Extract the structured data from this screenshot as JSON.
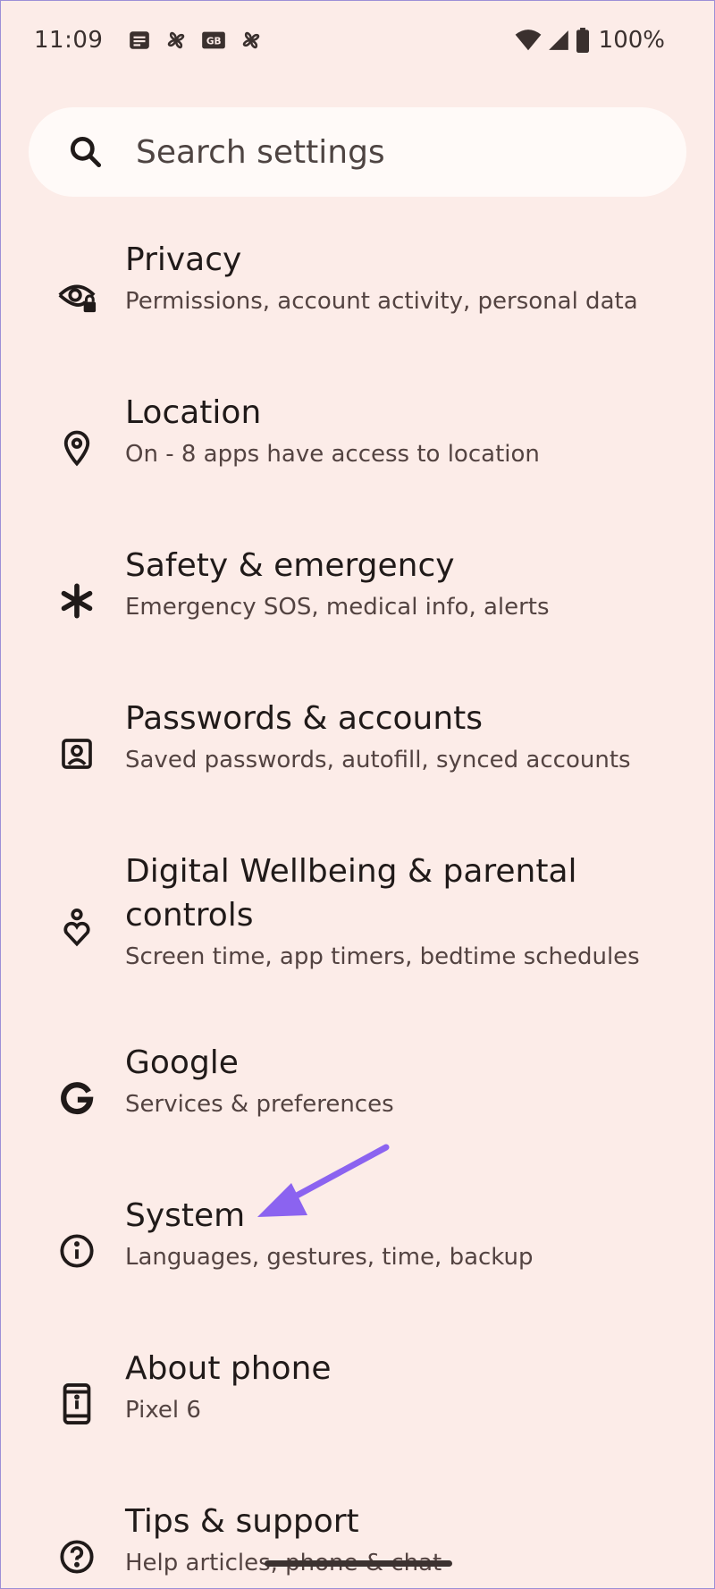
{
  "status_bar": {
    "time": "11:09",
    "left_icons": [
      "news-icon",
      "pinwheel-icon",
      "gmail-business-icon",
      "pinwheel-icon"
    ],
    "right_icons": [
      "wifi-icon",
      "cell-signal-icon",
      "battery-icon"
    ],
    "battery": "100%"
  },
  "search": {
    "placeholder": "Search settings"
  },
  "items": [
    {
      "title": "Privacy",
      "subtitle": "Permissions, account activity, personal data",
      "icon": "privacy-eye-lock-icon"
    },
    {
      "title": "Location",
      "subtitle": "On - 8 apps have access to location",
      "icon": "location-pin-icon"
    },
    {
      "title": "Safety & emergency",
      "subtitle": "Emergency SOS, medical info, alerts",
      "icon": "asterisk-icon"
    },
    {
      "title": "Passwords & accounts",
      "subtitle": "Saved passwords, autofill, synced accounts",
      "icon": "account-box-icon"
    },
    {
      "title": "Digital Wellbeing & parental controls",
      "subtitle": "Screen time, app timers, bedtime schedules",
      "icon": "wellbeing-icon"
    },
    {
      "title": "Google",
      "subtitle": "Services & preferences",
      "icon": "google-g-icon"
    },
    {
      "title": "System",
      "subtitle": "Languages, gestures, time, backup",
      "icon": "info-icon"
    },
    {
      "title": "About phone",
      "subtitle": "Pixel 6",
      "icon": "phone-icon"
    },
    {
      "title": "Tips & support",
      "subtitle": "Help articles, phone & chat",
      "icon": "help-icon"
    }
  ],
  "colors": {
    "background": "#fcece8",
    "search_bg": "#fffaf8",
    "annotation_arrow": "#8b63f0"
  }
}
